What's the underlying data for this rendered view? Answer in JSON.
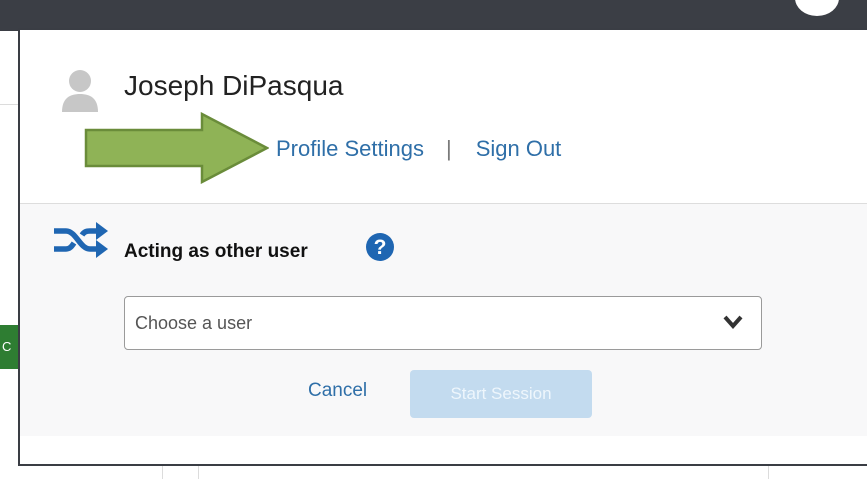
{
  "profile": {
    "user_name": "Joseph DiPasqua",
    "profile_settings_label": "Profile Settings",
    "separator": "|",
    "sign_out_label": "Sign Out"
  },
  "impersonation": {
    "title": "Acting as other user",
    "select_placeholder": "Choose a user",
    "cancel_label": "Cancel",
    "start_session_label": "Start Session"
  },
  "icons": [
    "user-avatar-icon",
    "shuffle-icon",
    "help-icon",
    "chevron-down-icon",
    "green-arrow-icon"
  ],
  "colors": {
    "top_bar": "#3b3e45",
    "link": "#2f6fa8",
    "accent_blue": "#1f66b2",
    "arrow_green": "#8fb356",
    "start_button_disabled": "#c3dbef",
    "section_background": "#f8f8f9"
  }
}
